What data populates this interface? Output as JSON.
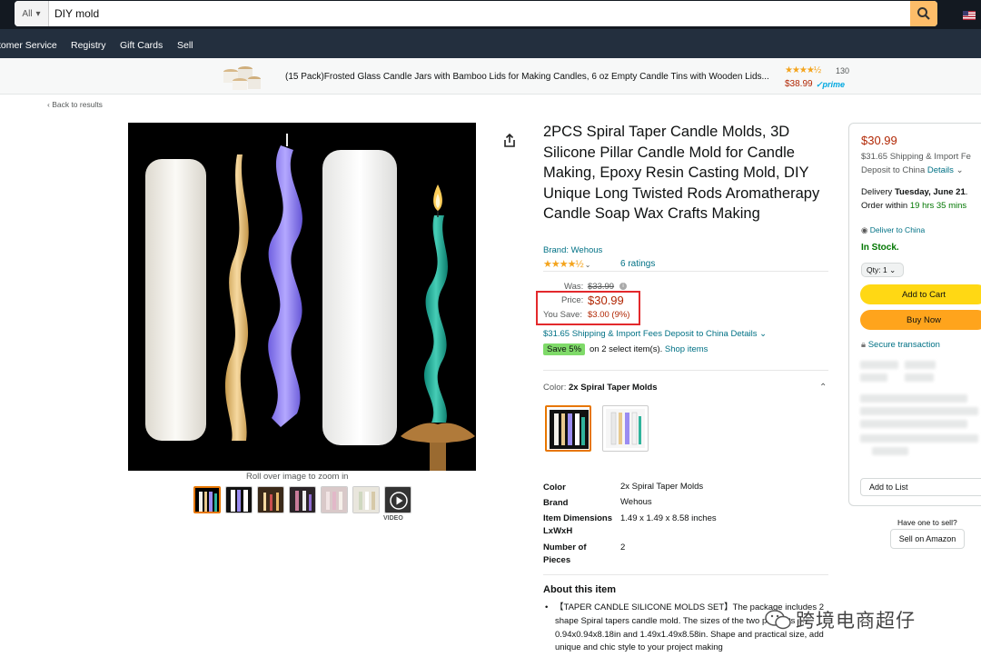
{
  "search": {
    "category": "All",
    "query": "DIY mold"
  },
  "nav": {
    "items": [
      "tomer Service",
      "Registry",
      "Gift Cards",
      "Sell"
    ]
  },
  "banner": {
    "text": "(15 Pack)Frosted Glass Candle Jars with Bamboo Lids for Making Candles, 6 oz Empty Candle Tins with Wooden Lids...",
    "stars": "★★★★½",
    "rating_count": "130",
    "price": "$38.99",
    "prime": "✓prime"
  },
  "back_link": "‹ Back to results",
  "gallery": {
    "zoom_hint": "Roll over image to zoom in",
    "video_label": "VIDEO"
  },
  "product": {
    "title": "2PCS Spiral Taper Candle Molds, 3D Silicone Pillar Candle Mold for Candle Making, Epoxy Resin Casting Mold, DIY Unique Long Twisted Rods Aromatherapy Candle Soap Wax Crafts Making",
    "brand": "Brand: Wehous",
    "stars": "★★★★½",
    "ratings": "6 ratings",
    "was_label": "Was:",
    "was_price": "$33.99",
    "price_label": "Price:",
    "price": "$30.99",
    "save_label": "You Save:",
    "save_value": "$3.00 (9%)",
    "shipping": "$31.65 Shipping & Import Fees Deposit to China Details ⌄",
    "coupon_badge": "Save 5%",
    "coupon_text": "on 2 select item(s).",
    "coupon_link": "Shop items",
    "color_label": "Color:",
    "color_value": "2x Spiral Taper Molds"
  },
  "specs": [
    {
      "key": "Color",
      "value": "2x Spiral Taper Molds"
    },
    {
      "key": "Brand",
      "value": "Wehous"
    },
    {
      "key": "Item Dimensions LxWxH",
      "value": "1.49 x 1.49 x 8.58 inches"
    },
    {
      "key": "Number of Pieces",
      "value": "2"
    }
  ],
  "about": {
    "title": "About this item",
    "body": "【TAPER CANDLE SILICONE MOLDS SET】The package includes 2 shape Spiral tapers candle mold. The sizes of the two products are 0.94x0.94x8.18in and 1.49x1.49x8.58in. Shape and practical size, add unique and chic style to your project making"
  },
  "watermark": "跨境电商超仔",
  "buybox": {
    "price": "$30.99",
    "ship_line1": "$31.65 Shipping & Import Fe",
    "ship_line2": "Deposit to China",
    "ship_link": "Details",
    "delivery_prefix": "Delivery",
    "delivery_date": "Tuesday, June 21",
    "order_prefix": "Order within",
    "order_time": "19 hrs 35 mins",
    "deliver_to": "Deliver to China",
    "stock": "In Stock.",
    "qty": "Qty: 1",
    "add_to_cart": "Add to Cart",
    "buy_now": "Buy Now",
    "secure": "Secure transaction",
    "add_to_list": "Add to List",
    "sell_question": "Have one to sell?",
    "sell_button": "Sell on Amazon"
  },
  "colors": {
    "price_red": "#B12704",
    "link_teal": "#007185",
    "cart_yellow": "#FFD814",
    "buy_orange": "#FFA41C",
    "nav_dark": "#131921",
    "highlight_red": "#E3292C"
  }
}
